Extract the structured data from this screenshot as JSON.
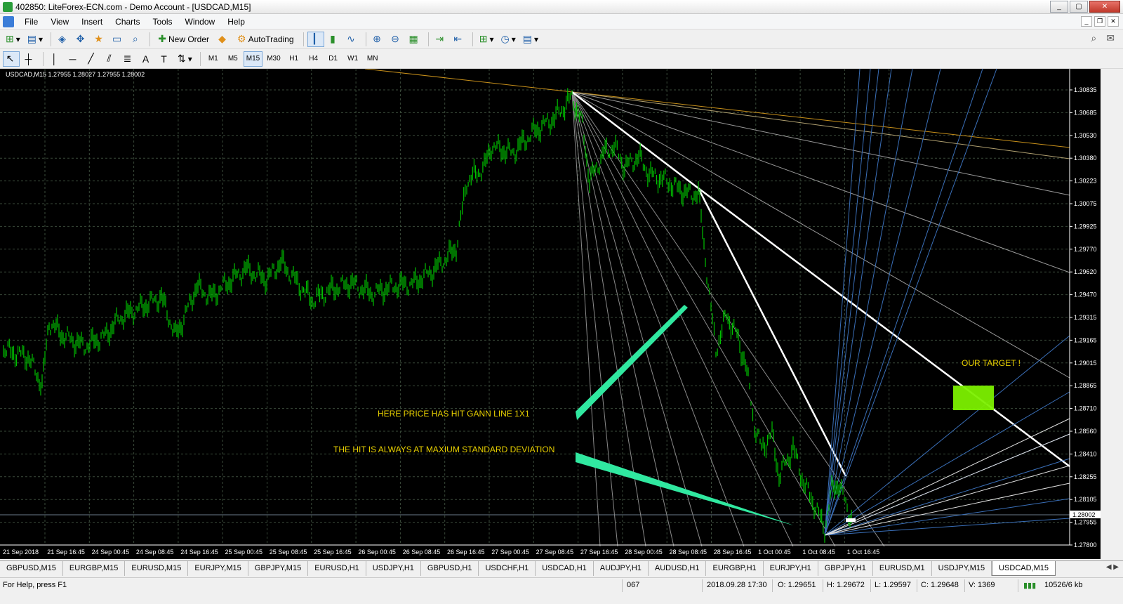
{
  "window": {
    "title": "402850: LiteForex-ECN.com - Demo Account - [USDCAD,M15]",
    "buttons": [
      "_",
      "▢",
      "✕"
    ]
  },
  "menu": [
    "File",
    "View",
    "Insert",
    "Charts",
    "Tools",
    "Window",
    "Help"
  ],
  "toolbar": {
    "new_order": "New Order",
    "auto_trading": "AutoTrading"
  },
  "timeframes": [
    "M1",
    "M5",
    "M15",
    "M30",
    "H1",
    "H4",
    "D1",
    "W1",
    "MN"
  ],
  "active_timeframe": "M15",
  "chart": {
    "info": "USDCAD,M15  1.27955 1.28027 1.27955 1.28002",
    "current_price": "1.28002",
    "candle_color": "#00c000",
    "y_labels": [
      "1.30835",
      "1.30685",
      "1.30530",
      "1.30380",
      "1.30223",
      "1.30075",
      "1.29925",
      "1.29770",
      "1.29620",
      "1.29470",
      "1.29315",
      "1.29165",
      "1.29015",
      "1.28865",
      "1.28710",
      "1.28560",
      "1.28410",
      "1.28255",
      "1.28105",
      "1.27955",
      "1.27800"
    ],
    "x_labels": [
      "21 Sep 2018",
      "21 Sep 16:45",
      "24 Sep 00:45",
      "24 Sep 08:45",
      "24 Sep 16:45",
      "25 Sep 00:45",
      "25 Sep 08:45",
      "25 Sep 16:45",
      "26 Sep 00:45",
      "26 Sep 08:45",
      "26 Sep 16:45",
      "27 Sep 00:45",
      "27 Sep 08:45",
      "27 Sep 16:45",
      "28 Sep 00:45",
      "28 Sep 08:45",
      "28 Sep 16:45",
      "1 Oct 00:45",
      "1 Oct 08:45",
      "1 Oct 16:45"
    ],
    "annotations": {
      "gann_hit": "HERE PRICE HAS HIT GANN LINE 1X1",
      "std_dev": "THE HIT IS ALWAYS AT MAXIUM STANDARD DEVIATION",
      "target": "OUR TARGET !"
    },
    "annotation_color": "#e8d000"
  },
  "tabs": [
    "GBPUSD,M15",
    "EURGBP,M15",
    "EURUSD,M15",
    "EURJPY,M15",
    "GBPJPY,M15",
    "EURUSD,H1",
    "USDJPY,H1",
    "GBPUSD,H1",
    "USDCHF,H1",
    "USDCAD,H1",
    "AUDJPY,H1",
    "AUDUSD,H1",
    "EURGBP,H1",
    "EURJPY,H1",
    "GBPJPY,H1",
    "EURUSD,M1",
    "USDJPY,M15",
    "USDCAD,M15"
  ],
  "active_tab": "USDCAD,M15",
  "status": {
    "help": "For Help, press F1",
    "profile": "067",
    "datetime": "2018.09.28 17:30",
    "open": "O: 1.29651",
    "high": "H: 1.29672",
    "low": "L: 1.29597",
    "close": "C: 1.29648",
    "volume": "V: 1369",
    "traffic": "10526/6 kb"
  }
}
